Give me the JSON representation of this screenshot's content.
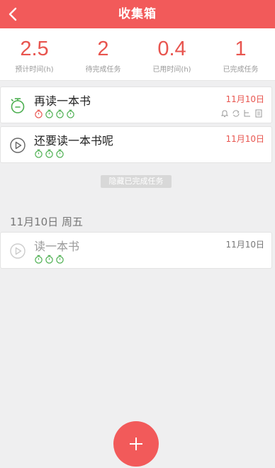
{
  "header": {
    "title": "收集箱",
    "back_icon": "chevron-left-icon"
  },
  "stats": [
    {
      "value": "2.5",
      "label": "预计时间(h)"
    },
    {
      "value": "2",
      "label": "待完成任务"
    },
    {
      "value": "0.4",
      "label": "已用时间(h)"
    },
    {
      "value": "1",
      "label": "已完成任务"
    }
  ],
  "tasks": [
    {
      "title": "再读一本书",
      "date": "11月10日",
      "icon": "stopwatch-icon",
      "pomodoros": [
        "red",
        "green",
        "green",
        "green"
      ],
      "tools": [
        "bell-icon",
        "repeat-icon",
        "subtask-icon",
        "note-icon"
      ]
    },
    {
      "title": "还要读一本书呢",
      "date": "11月10日",
      "icon": "play-icon",
      "pomodoros": [
        "green",
        "green",
        "green"
      ]
    }
  ],
  "hide_completed_label": "隐藏已完成任务",
  "completed_section": {
    "date_header": "11月10日 周五",
    "tasks": [
      {
        "title": "读一本书",
        "date": "11月10日",
        "icon": "play-icon",
        "pomodoros": [
          "green",
          "green",
          "green"
        ]
      }
    ]
  },
  "fab": {
    "icon": "plus-icon"
  },
  "colors": {
    "accent": "#f25a5a",
    "stat_value": "#e8554f",
    "pomo_green": "#4caf50",
    "pomo_red": "#e8554f"
  }
}
